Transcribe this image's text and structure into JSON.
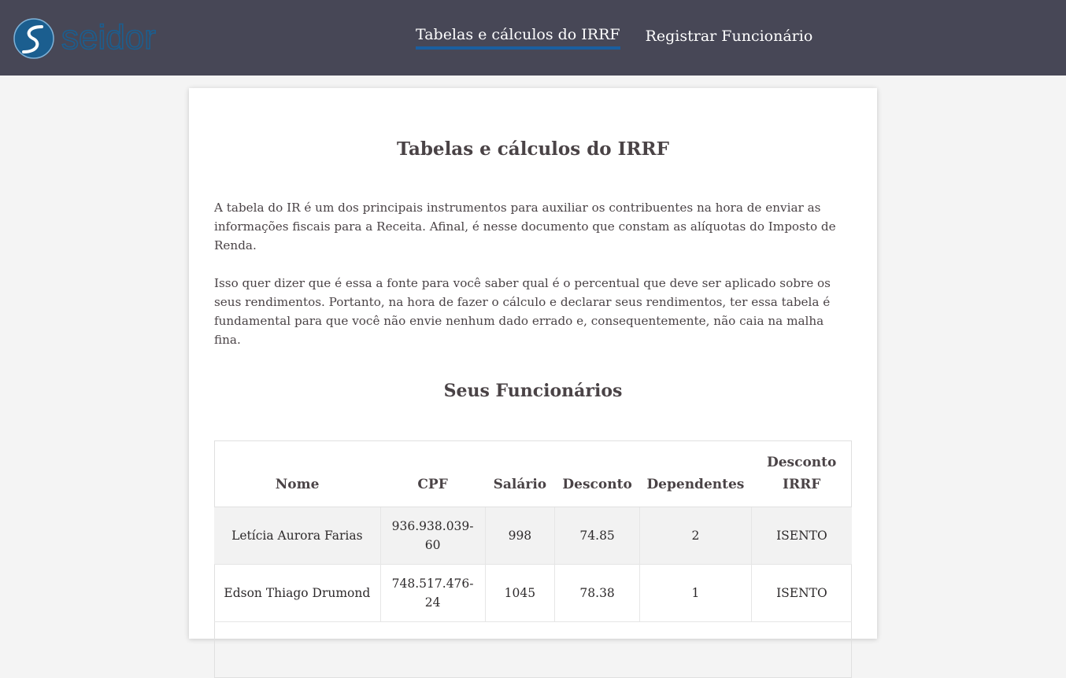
{
  "header": {
    "logo_text": "seidor",
    "nav": [
      {
        "label": "Tabelas e cálculos do IRRF",
        "active": true
      },
      {
        "label": "Registrar Funcionário",
        "active": false
      }
    ]
  },
  "main": {
    "title": "Tabelas e cálculos do IRRF",
    "paragraph1": "A tabela do IR é um dos principais instrumentos para auxiliar os contribuentes na hora de enviar as informações fiscais para a Receita. Afinal, é nesse documento que constam as alíquotas do Imposto de Renda.",
    "paragraph2": "Isso quer dizer que é essa a fonte para você saber qual é o percentual que deve ser aplicado sobre os seus rendimentos. Portanto, na hora de fazer o cálculo e declarar seus rendimentos, ter essa tabela é fundamental para que você não envie nenhum dado errado e, consequentemente, não caia na malha fina.",
    "employees_title": "Seus Funcionários",
    "table": {
      "headers": [
        "Nome",
        "CPF",
        "Salário",
        "Desconto",
        "Dependentes",
        "Desconto IRRF"
      ],
      "rows": [
        [
          "Letícia Aurora Farias",
          "936.938.039-60",
          "998",
          "74.85",
          "2",
          "ISENTO"
        ],
        [
          "Edson Thiago Drumond",
          "748.517.476-24",
          "1045",
          "78.38",
          "1",
          "ISENTO"
        ]
      ]
    }
  },
  "colors": {
    "header_bg": "#474756",
    "accent": "#1a5fa0",
    "logo_blue": "#1b5e8f"
  }
}
